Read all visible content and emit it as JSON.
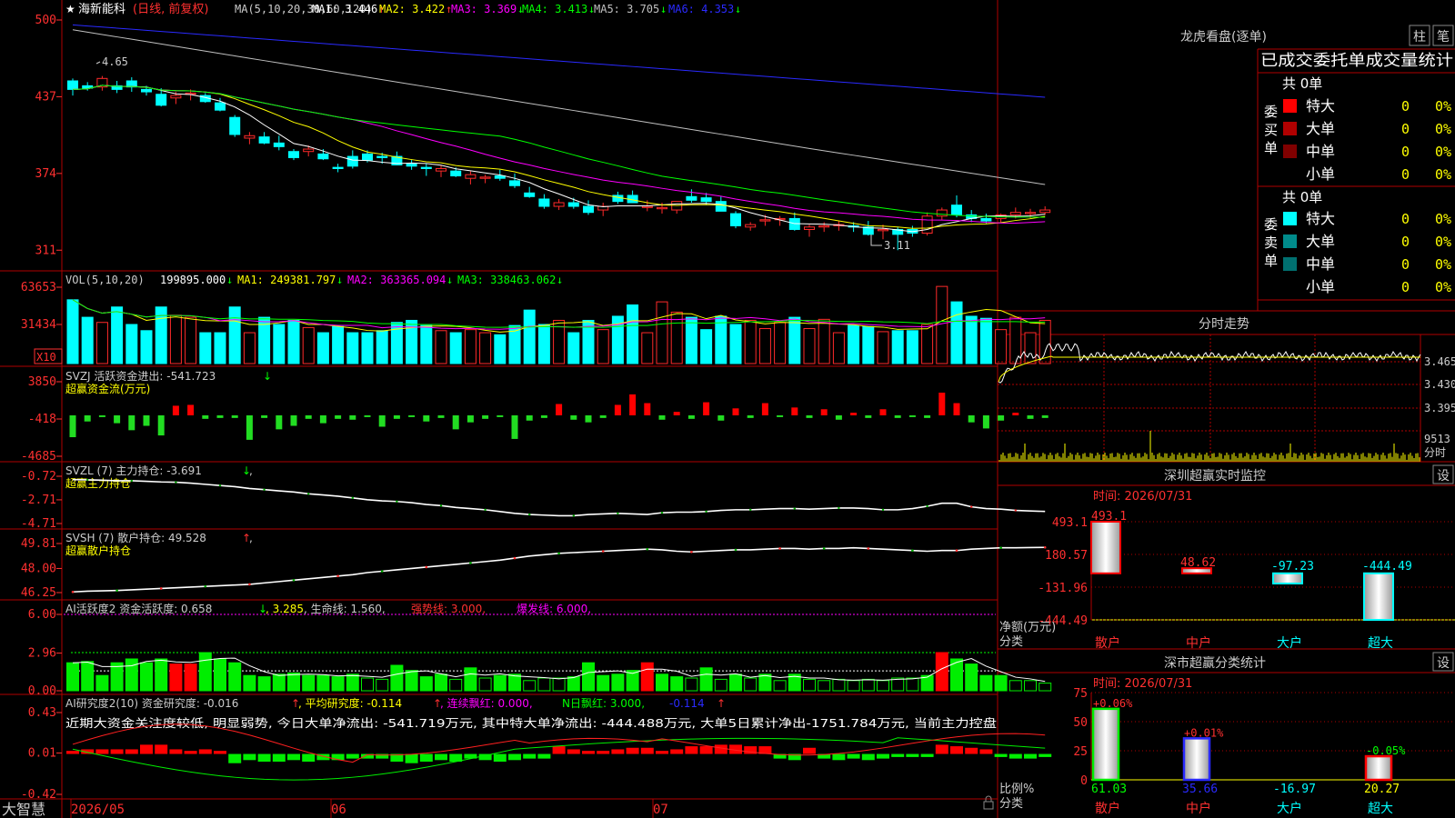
{
  "header": {
    "star": "★",
    "stock_name": "海新能科",
    "period": "(日线, 前复权)",
    "ma_label": "MA(5,10,20,30,60,120)",
    "ma_values": [
      {
        "label": "MA1: 3.446",
        "arrow": "↑",
        "color": "#ffffff"
      },
      {
        "label": "MA2: 3.422",
        "arrow": "↑",
        "color": "#ffff00"
      },
      {
        "label": "MA3: 3.369",
        "arrow": "↓",
        "color": "#ff00ff"
      },
      {
        "label": "MA4: 3.413",
        "arrow": "↓",
        "color": "#00ff00"
      },
      {
        "label": "MA5: 3.705",
        "arrow": "↓",
        "color": "#c0c0c0"
      },
      {
        "label": "MA6: 4.353",
        "arrow": "↓",
        "color": "#2a2aff"
      }
    ]
  },
  "price_axis": [
    "500",
    "437",
    "374",
    "311"
  ],
  "price_annotations": {
    "high": "4.65",
    "low": "3.11"
  },
  "vol_header": {
    "label": "VOL(5,10,20)",
    "items": [
      {
        "text": "199895.000",
        "arrow": "↓",
        "color": "#ffffff"
      },
      {
        "text": "MA1: 249381.797",
        "arrow": "↓",
        "color": "#ffff00"
      },
      {
        "text": "MA2: 363365.094",
        "arrow": "↓",
        "color": "#ff00ff"
      },
      {
        "text": "MA3: 338463.062",
        "arrow": "↓",
        "color": "#00ff00"
      }
    ]
  },
  "vol_axis": [
    "63653",
    "31434"
  ],
  "vol_unit": "X10",
  "svzj": {
    "line1": "SVZJ  活跃资金进出: -541.723",
    "arrow": "↓",
    "line2": "超赢资金流(万元)",
    "axis": [
      "3850",
      "-418",
      "-4685"
    ]
  },
  "svzl": {
    "line1": "SVZL (7) 主力持仓: -3.691",
    "arrow": "↓",
    "tail": ",",
    "line2": "超赢主力持仓",
    "axis": [
      "-0.72",
      "-2.71",
      "-4.71"
    ]
  },
  "svsh": {
    "line1": "SVSH (7) 散户持仓: 49.528",
    "arrow": "↑",
    "tail": ",",
    "line2": "超赢散户持仓",
    "axis": [
      "49.81",
      "48.00",
      "46.25"
    ]
  },
  "ai1": {
    "prefix": "AI活跃度2 资金活跃度: 0.658",
    "arrow1": "↓",
    "v2": ", 3.285",
    "life": ", 生命线: 1.560,",
    "strong": " 强势线: 3.000,",
    "burst": " 爆发线: 6.000,",
    "axis": [
      "6.00",
      "2.96",
      "0.00"
    ]
  },
  "ai2": {
    "prefix": "AI研究度2(10) 资金研究度: -0.016",
    "arrow1": "↑",
    "avg": ", 平均研究度: -0.114",
    "arrow2": "↑",
    "lxpr": ", 连续飘红: 0.000,",
    "npr": " N日飘红: 3.000,",
    "last": " -0.114",
    "arrow3": "↑",
    "comment": "近期大资金关注度较低, 明显弱势, 今日大单净流出: -541.719万元, 其中特大单净流出: -444.488万元, 大单5日累计净出-1751.784万元, 当前主力控盘",
    "axis": [
      "0.43",
      "0.01",
      "-0.42"
    ]
  },
  "bottom_bar": {
    "brand": "大智慧",
    "dates": [
      "2026/05",
      "06",
      "07"
    ]
  },
  "right_panel": {
    "title": "龙虎看盘(逐单)",
    "btn_bar": "柱",
    "btn_pen": "笔",
    "tabs": "已成交委托单成交量统计",
    "buy_label": "委买单",
    "sell_label": "委卖单",
    "buy_total": "共 0单",
    "sell_total": "共 0单",
    "buy_rows": [
      {
        "name": "特大",
        "count": "0",
        "pct": "0%",
        "color": "#ff0000"
      },
      {
        "name": "大单",
        "count": "0",
        "pct": "0%",
        "color": "#b00000"
      },
      {
        "name": "中单",
        "count": "0",
        "pct": "0%",
        "color": "#800000"
      },
      {
        "name": "小单",
        "count": "0",
        "pct": "0%",
        "color": "#000000"
      }
    ],
    "sell_rows": [
      {
        "name": "特大",
        "count": "0",
        "pct": "0%",
        "color": "#00ffff"
      },
      {
        "name": "大单",
        "count": "0",
        "pct": "0%",
        "color": "#008b8b"
      },
      {
        "name": "中单",
        "count": "0",
        "pct": "0%",
        "color": "#007070"
      },
      {
        "name": "小单",
        "count": "0",
        "pct": "0%",
        "color": "#000000"
      }
    ],
    "intraday_title": "分时走势",
    "intraday_axis": [
      "3.465",
      "3.430",
      "3.395"
    ],
    "intraday_vol": "9513",
    "intraday_vol_unit": "分时",
    "sz_title": "深圳超赢实时监控",
    "sz_btn": "设",
    "sz_time": "时间: 2026/07/31",
    "sz_axis": [
      "493.1",
      "180.57",
      "-131.96",
      "-444.49"
    ],
    "sz_ylabel": "净额(万元)",
    "sz_xlabel": "分类",
    "sz_categories": [
      "散户",
      "中户",
      "大户",
      "超大"
    ],
    "sz_values": [
      "493.1",
      "48.62",
      "-97.23",
      "-444.49"
    ],
    "cls_title": "深市超赢分类统计",
    "cls_btn": "设",
    "cls_time": "时间: 2026/07/31",
    "cls_axis": [
      "75",
      "50",
      "25",
      "0"
    ],
    "cls_ylabel": "比例%",
    "cls_xlabel": "分类",
    "cls_categories": [
      "散户",
      "中户",
      "大户",
      "超大"
    ],
    "cls_top_labels": [
      "+0.06%",
      "+0.01%",
      "",
      "-0.05%"
    ],
    "cls_bottom_labels": [
      "61.03",
      "35.66",
      "-16.97",
      "20.27"
    ]
  },
  "chart_data": [
    {
      "type": "candlestick",
      "name": "price",
      "ylim": [
        3.0,
        5.0
      ],
      "candles": [
        [
          4.5,
          4.52,
          4.38,
          4.43
        ],
        [
          4.46,
          4.49,
          4.42,
          4.44
        ],
        [
          4.45,
          4.54,
          4.42,
          4.52
        ],
        [
          4.46,
          4.5,
          4.4,
          4.43
        ],
        [
          4.5,
          4.53,
          4.41,
          4.45
        ],
        [
          4.43,
          4.46,
          4.38,
          4.41
        ],
        [
          4.39,
          4.44,
          4.29,
          4.3
        ],
        [
          4.36,
          4.41,
          4.31,
          4.38
        ],
        [
          4.39,
          4.43,
          4.34,
          4.4
        ],
        [
          4.38,
          4.4,
          4.32,
          4.33
        ],
        [
          4.32,
          4.36,
          4.25,
          4.26
        ],
        [
          4.2,
          4.22,
          4.04,
          4.06
        ],
        [
          4.03,
          4.08,
          3.98,
          4.05
        ],
        [
          4.04,
          4.08,
          3.98,
          3.99
        ],
        [
          3.99,
          4.05,
          3.93,
          3.96
        ],
        [
          3.92,
          3.94,
          3.85,
          3.87
        ],
        [
          3.92,
          3.97,
          3.88,
          3.94
        ],
        [
          3.9,
          3.94,
          3.85,
          3.86
        ],
        [
          3.79,
          3.82,
          3.75,
          3.78
        ],
        [
          3.88,
          3.93,
          3.78,
          3.8
        ],
        [
          3.9,
          3.93,
          3.83,
          3.85
        ],
        [
          3.88,
          3.91,
          3.82,
          3.87
        ],
        [
          3.88,
          3.92,
          3.82,
          3.81
        ],
        [
          3.82,
          3.85,
          3.77,
          3.8
        ],
        [
          3.79,
          3.82,
          3.72,
          3.78
        ],
        [
          3.76,
          3.81,
          3.71,
          3.78
        ],
        [
          3.76,
          3.79,
          3.71,
          3.72
        ],
        [
          3.7,
          3.76,
          3.65,
          3.73
        ],
        [
          3.7,
          3.73,
          3.66,
          3.71
        ],
        [
          3.72,
          3.77,
          3.68,
          3.7
        ],
        [
          3.68,
          3.74,
          3.62,
          3.64
        ],
        [
          3.58,
          3.63,
          3.54,
          3.55
        ],
        [
          3.53,
          3.57,
          3.45,
          3.47
        ],
        [
          3.47,
          3.53,
          3.44,
          3.5
        ],
        [
          3.5,
          3.54,
          3.45,
          3.47
        ],
        [
          3.47,
          3.52,
          3.4,
          3.42
        ],
        [
          3.44,
          3.5,
          3.39,
          3.47
        ],
        [
          3.56,
          3.59,
          3.49,
          3.51
        ],
        [
          3.56,
          3.6,
          3.51,
          3.5
        ],
        [
          3.46,
          3.52,
          3.43,
          3.47
        ],
        [
          3.45,
          3.5,
          3.41,
          3.46
        ],
        [
          3.44,
          3.48,
          3.41,
          3.51
        ],
        [
          3.55,
          3.61,
          3.5,
          3.52
        ],
        [
          3.54,
          3.58,
          3.48,
          3.51
        ],
        [
          3.51,
          3.55,
          3.46,
          3.43
        ],
        [
          3.41,
          3.43,
          3.29,
          3.31
        ],
        [
          3.3,
          3.34,
          3.27,
          3.32
        ],
        [
          3.35,
          3.4,
          3.31,
          3.36
        ],
        [
          3.36,
          3.39,
          3.31,
          3.37
        ],
        [
          3.37,
          3.42,
          3.27,
          3.28
        ],
        [
          3.28,
          3.32,
          3.22,
          3.3
        ],
        [
          3.3,
          3.34,
          3.26,
          3.31
        ],
        [
          3.31,
          3.35,
          3.27,
          3.32
        ],
        [
          3.31,
          3.34,
          3.26,
          3.3
        ],
        [
          3.3,
          3.35,
          3.23,
          3.24
        ],
        [
          3.27,
          3.32,
          3.2,
          3.28
        ],
        [
          3.28,
          3.3,
          3.11,
          3.24
        ],
        [
          3.28,
          3.31,
          3.22,
          3.25
        ],
        [
          3.25,
          3.42,
          3.23,
          3.39
        ],
        [
          3.39,
          3.46,
          3.36,
          3.44
        ],
        [
          3.48,
          3.56,
          3.38,
          3.4
        ],
        [
          3.4,
          3.44,
          3.34,
          3.37
        ],
        [
          3.37,
          3.41,
          3.33,
          3.35
        ],
        [
          3.37,
          3.41,
          3.34,
          3.4
        ],
        [
          3.4,
          3.46,
          3.37,
          3.42
        ],
        [
          3.41,
          3.45,
          3.37,
          3.42
        ],
        [
          3.42,
          3.47,
          3.4,
          3.44
        ]
      ]
    },
    {
      "type": "bar",
      "name": "volume",
      "ylim": [
        0,
        70000
      ],
      "values": [
        62000,
        45000,
        40000,
        55000,
        38000,
        32000,
        55000,
        47000,
        45000,
        30000,
        30000,
        55000,
        30000,
        45000,
        38000,
        42000,
        35000,
        30000,
        36000,
        30000,
        30000,
        32000,
        40000,
        42000,
        37000,
        32000,
        30000,
        33000,
        30000,
        28000,
        37000,
        52000,
        38000,
        42000,
        30000,
        42000,
        33000,
        46000,
        57000,
        30000,
        60000,
        50000,
        45000,
        33000,
        46000,
        38000,
        42000,
        34000,
        40000,
        45000,
        34000,
        43000,
        30000,
        37000,
        36000,
        31000,
        32000,
        32000,
        38000,
        75000,
        60000,
        46000,
        44000,
        33000,
        45000,
        30000,
        42000
      ]
    },
    {
      "type": "bar",
      "name": "svzj",
      "ylim": [
        -4685,
        3850
      ],
      "values": [
        -2500,
        -700,
        -200,
        -900,
        -1700,
        -1200,
        -2300,
        1100,
        1200,
        -400,
        -300,
        -300,
        -2800,
        -300,
        -1600,
        -1200,
        -400,
        -900,
        -400,
        -500,
        -200,
        -1300,
        -400,
        -200,
        -700,
        -300,
        -1600,
        -800,
        -400,
        -200,
        -2700,
        -600,
        -300,
        1300,
        -500,
        -800,
        -300,
        1200,
        2400,
        1400,
        -500,
        400,
        -400,
        1500,
        -600,
        800,
        -300,
        1400,
        -200,
        900,
        -300,
        700,
        -500,
        300,
        -300,
        700,
        -300,
        -200,
        -300,
        2600,
        1400,
        -800,
        -1500,
        -600,
        300,
        -400,
        -300
      ]
    },
    {
      "type": "line",
      "name": "svzl",
      "ylim": [
        -4.71,
        -0.72
      ],
      "values": [
        -1.0,
        -1.02,
        -1.05,
        -1.1,
        -1.1,
        -1.15,
        -1.2,
        -1.22,
        -1.3,
        -1.4,
        -1.5,
        -1.6,
        -1.75,
        -1.85,
        -1.95,
        -2.05,
        -2.2,
        -2.3,
        -2.4,
        -2.55,
        -2.7,
        -2.8,
        -2.85,
        -2.95,
        -3.1,
        -3.2,
        -3.35,
        -3.45,
        -3.55,
        -3.7,
        -3.85,
        -3.95,
        -4.0,
        -4.05,
        -4.05,
        -3.95,
        -3.9,
        -3.85,
        -3.9,
        -3.95,
        -3.8,
        -3.75,
        -3.75,
        -3.7,
        -3.6,
        -3.55,
        -3.55,
        -3.5,
        -3.45,
        -3.45,
        -3.5,
        -3.45,
        -3.4,
        -3.4,
        -3.45,
        -3.55,
        -3.55,
        -3.45,
        -3.25,
        -3.0,
        -3.0,
        -3.3,
        -3.45,
        -3.5,
        -3.6,
        -3.65,
        -3.69
      ]
    },
    {
      "type": "line",
      "name": "svsh",
      "ylim": [
        46.25,
        49.81
      ],
      "values": [
        46.3,
        46.35,
        46.38,
        46.4,
        46.45,
        46.5,
        46.55,
        46.6,
        46.65,
        46.7,
        46.75,
        46.8,
        46.85,
        46.95,
        47.05,
        47.15,
        47.25,
        47.35,
        47.45,
        47.55,
        47.7,
        47.8,
        47.9,
        48.0,
        48.1,
        48.2,
        48.3,
        48.4,
        48.5,
        48.6,
        48.75,
        48.9,
        49.0,
        49.1,
        49.15,
        49.2,
        49.25,
        49.3,
        49.35,
        49.4,
        49.35,
        49.25,
        49.2,
        49.25,
        49.3,
        49.35,
        49.35,
        49.4,
        49.45,
        49.45,
        49.4,
        49.45,
        49.45,
        49.5,
        49.45,
        49.4,
        49.35,
        49.3,
        49.25,
        49.3,
        49.3,
        49.4,
        49.45,
        49.5,
        49.5,
        49.52,
        49.53
      ]
    },
    {
      "type": "bar",
      "name": "ai_activity",
      "ylim": [
        0,
        6.0
      ],
      "values": [
        2.2,
        2.3,
        1.2,
        2.2,
        2.5,
        2.2,
        2.5,
        2.1,
        2.1,
        3.0,
        2.5,
        2.2,
        1.2,
        1.1,
        1.3,
        1.4,
        1.2,
        1.2,
        1.1,
        1.3,
        1.0,
        0.9,
        2.0,
        1.6,
        1.1,
        1.3,
        0.9,
        1.8,
        1.0,
        1.2,
        1.3,
        0.8,
        1.0,
        1.0,
        1.1,
        2.2,
        1.2,
        1.3,
        1.6,
        2.2,
        1.3,
        1.1,
        1.0,
        1.8,
        0.9,
        1.3,
        1.0,
        1.3,
        0.8,
        1.3,
        0.9,
        0.8,
        0.9,
        0.8,
        0.9,
        0.8,
        1.0,
        1.0,
        1.2,
        3.0,
        2.5,
        2.1,
        1.2,
        1.2,
        0.8,
        0.8,
        0.6
      ]
    },
    {
      "type": "bar",
      "name": "ai_research",
      "ylim": [
        -0.42,
        0.43
      ],
      "values": [
        0.02,
        0.03,
        0.03,
        0.03,
        0.03,
        0.06,
        0.06,
        0.03,
        0.02,
        0.03,
        0.02,
        -0.06,
        -0.04,
        -0.05,
        -0.05,
        -0.04,
        -0.05,
        -0.04,
        -0.04,
        -0.03,
        -0.03,
        -0.03,
        -0.05,
        -0.06,
        -0.05,
        -0.04,
        -0.05,
        -0.03,
        -0.04,
        -0.05,
        -0.04,
        -0.03,
        -0.03,
        0.05,
        0.03,
        0.02,
        0.02,
        0.03,
        0.04,
        0.04,
        0.02,
        0.03,
        0.05,
        0.05,
        0.06,
        0.06,
        0.05,
        0.05,
        -0.03,
        -0.04,
        0.04,
        -0.03,
        -0.04,
        -0.03,
        -0.04,
        -0.03,
        -0.02,
        -0.02,
        -0.02,
        0.06,
        0.05,
        0.04,
        0.03,
        -0.02,
        -0.03,
        -0.03,
        -0.02
      ]
    },
    {
      "type": "bar",
      "name": "sz_net_amount",
      "categories": [
        "散户",
        "中户",
        "大户",
        "超大"
      ],
      "values": [
        493.1,
        48.62,
        -97.23,
        -444.49
      ],
      "ylim": [
        -444.49,
        493.1
      ]
    },
    {
      "type": "bar",
      "name": "sz_ratio",
      "categories": [
        "散户",
        "中户",
        "大户",
        "超大"
      ],
      "values": [
        61.03,
        35.66,
        -16.97,
        20.27
      ],
      "ylim": [
        0,
        75
      ]
    }
  ]
}
